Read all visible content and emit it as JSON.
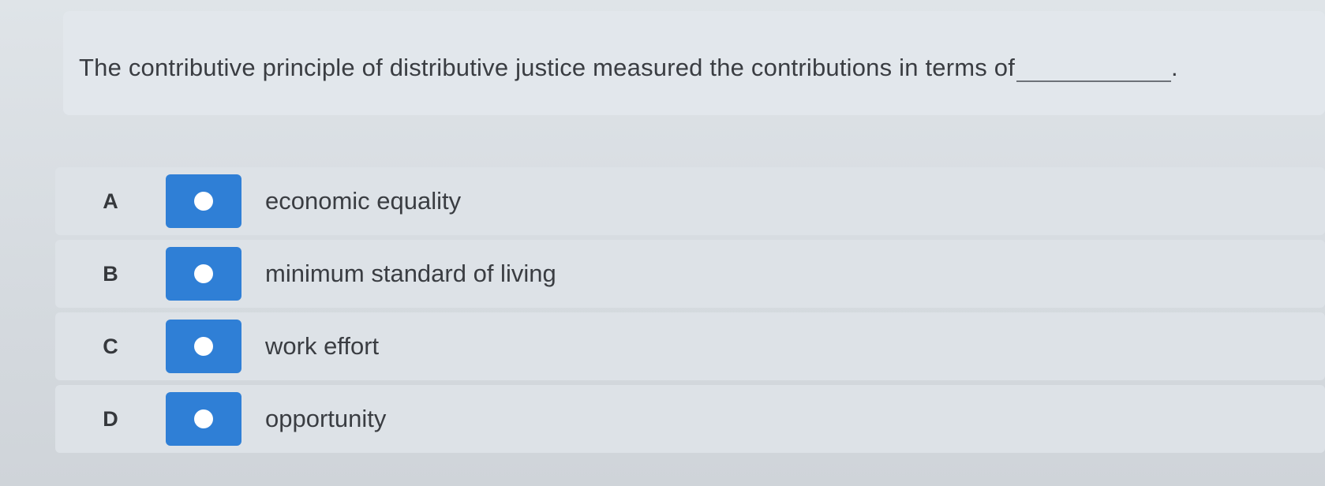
{
  "question": {
    "text": "The contributive principle of distributive justice measured the contributions in terms of",
    "trailing_punctuation": "."
  },
  "options": [
    {
      "letter": "A",
      "text": "economic equality"
    },
    {
      "letter": "B",
      "text": "minimum standard of living"
    },
    {
      "letter": "C",
      "text": "work effort"
    },
    {
      "letter": "D",
      "text": "opportunity"
    }
  ],
  "colors": {
    "radio_button": "#2f7fd6",
    "radio_dot": "#ffffff"
  },
  "icons": {
    "radio": "radio-button-icon"
  }
}
